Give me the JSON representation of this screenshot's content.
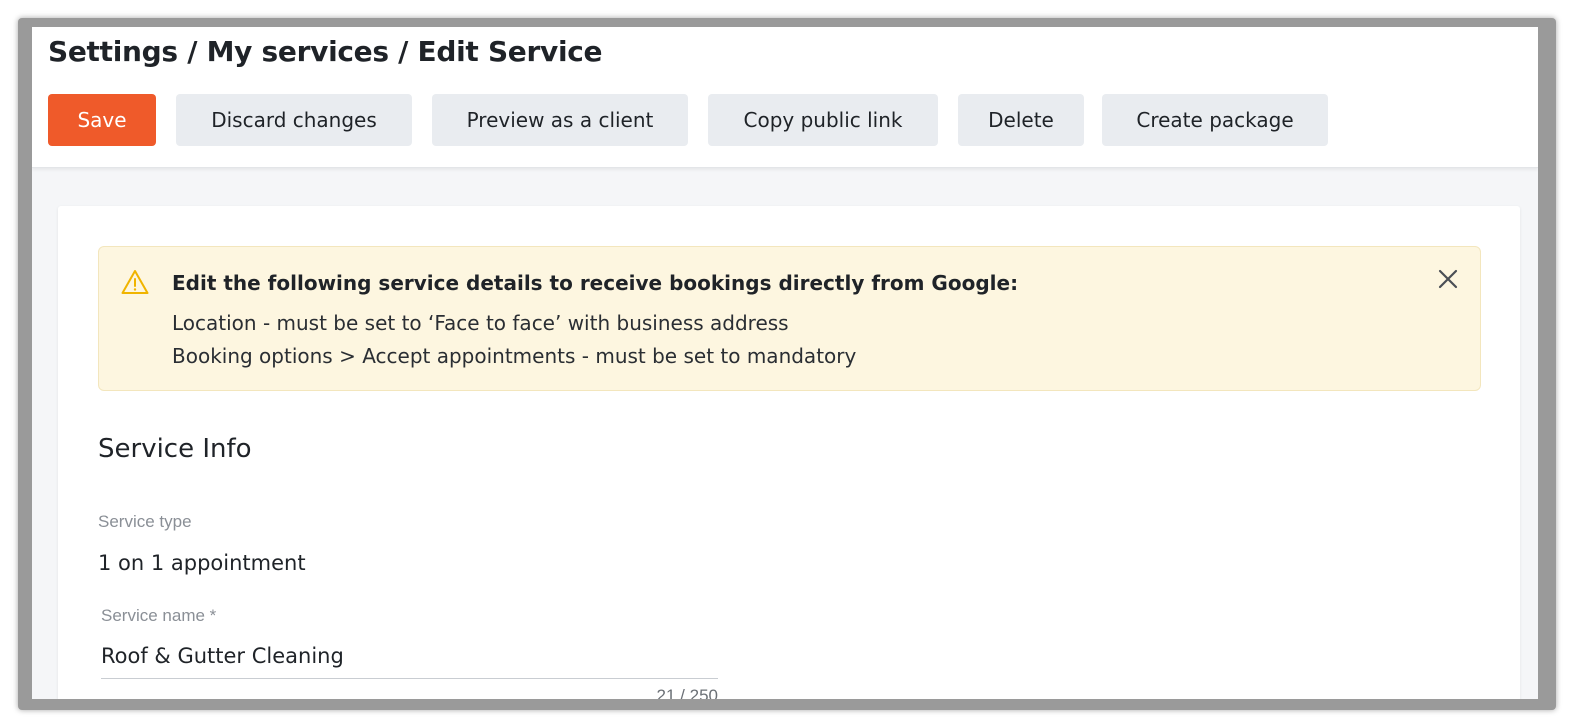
{
  "header": {
    "breadcrumb": "Settings / My services / Edit Service"
  },
  "toolbar": {
    "save_label": "Save",
    "discard_label": "Discard changes",
    "preview_label": "Preview as a client",
    "copy_link_label": "Copy public link",
    "delete_label": "Delete",
    "create_package_label": "Create package"
  },
  "alert": {
    "icon": "warning-icon",
    "title": "Edit the following service details to receive bookings directly from Google:",
    "line1": "Location - must be set to ‘Face to face’ with business address",
    "line2": "Booking options > Accept appointments - must be set to mandatory",
    "close_icon": "close-icon"
  },
  "service_info": {
    "section_title": "Service Info",
    "service_type_label": "Service type",
    "service_type_value": "1 on 1 appointment",
    "service_name_label": "Service name *",
    "service_name_value": "Roof & Gutter Cleaning",
    "service_name_counter": "21 / 250"
  },
  "colors": {
    "primary": "#ef5a2a",
    "alert_bg": "#fdf6e0",
    "warning": "#f0b400"
  }
}
